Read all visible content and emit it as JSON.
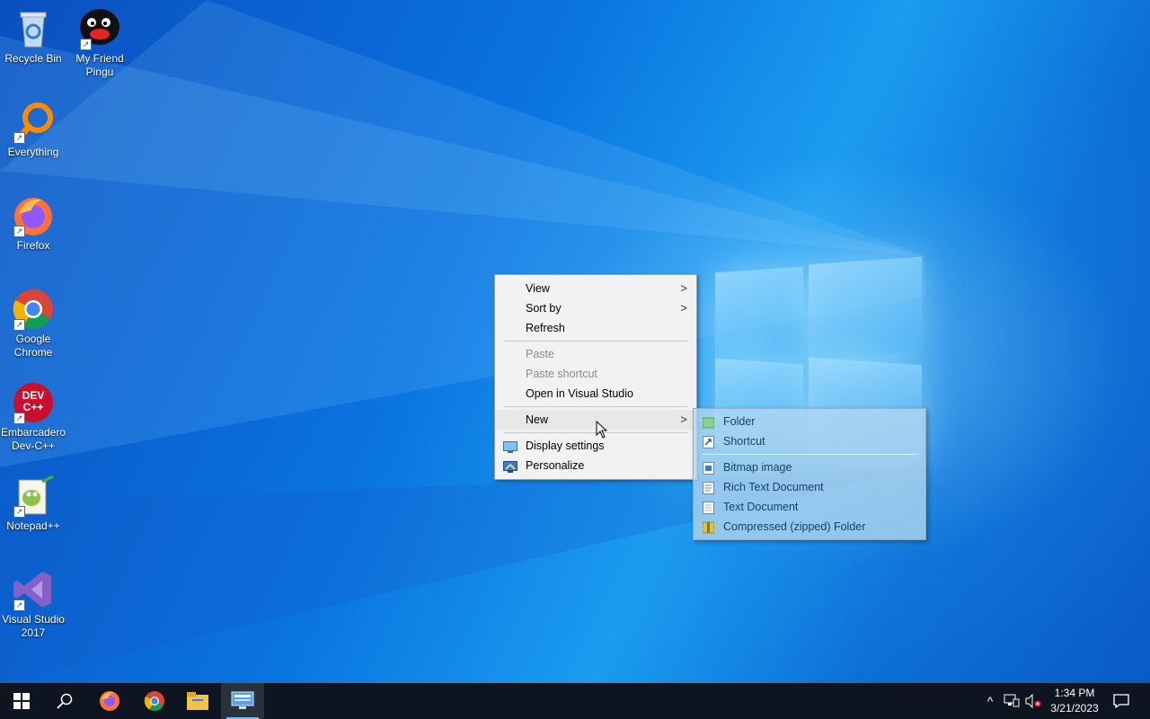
{
  "desktop_icons": [
    {
      "label": "Recycle Bin",
      "icon": "recycle-bin-icon"
    },
    {
      "label": "My Friend Pingu",
      "icon": "pingu-icon"
    },
    {
      "label": "Everything",
      "icon": "everything-search-icon"
    },
    {
      "label": "Firefox",
      "icon": "firefox-icon"
    },
    {
      "label": "Google Chrome",
      "icon": "chrome-icon"
    },
    {
      "label": "Embarcadero Dev-C++",
      "icon": "devcpp-icon",
      "glyph": "DEV C++"
    },
    {
      "label": "Notepad++",
      "icon": "notepadpp-icon"
    },
    {
      "label": "Visual Studio 2017",
      "icon": "visual-studio-icon"
    }
  ],
  "context_menu": {
    "items": [
      {
        "label": "View",
        "submenu": true,
        "enabled": true
      },
      {
        "label": "Sort by",
        "submenu": true,
        "enabled": true
      },
      {
        "label": "Refresh",
        "enabled": true
      },
      {
        "label": "Paste",
        "enabled": false
      },
      {
        "label": "Paste shortcut",
        "enabled": false
      },
      {
        "label": "Open in Visual Studio",
        "enabled": true
      },
      {
        "label": "New",
        "submenu": true,
        "enabled": true,
        "highlighted": true
      },
      {
        "label": "Display settings",
        "icon": "display-settings-icon",
        "enabled": true
      },
      {
        "label": "Personalize",
        "icon": "personalize-icon",
        "enabled": true
      }
    ],
    "chevron": ">"
  },
  "new_submenu": {
    "items": [
      {
        "label": "Folder",
        "icon": "folder-icon"
      },
      {
        "label": "Shortcut",
        "icon": "shortcut-icon"
      },
      {
        "label": "Bitmap image",
        "icon": "bitmap-image-icon"
      },
      {
        "label": "Rich Text Document",
        "icon": "rich-text-document-icon"
      },
      {
        "label": "Text Document",
        "icon": "text-document-icon"
      },
      {
        "label": "Compressed (zipped) Folder",
        "icon": "zip-folder-icon"
      }
    ]
  },
  "taskbar": {
    "pinned": [
      {
        "name": "start",
        "icon": "windows-start-icon"
      },
      {
        "name": "search",
        "icon": "search-icon"
      },
      {
        "name": "firefox",
        "icon": "firefox-icon"
      },
      {
        "name": "chrome",
        "icon": "chrome-icon"
      },
      {
        "name": "file-explorer",
        "icon": "file-explorer-icon"
      },
      {
        "name": "remote-desktop",
        "icon": "remote-desktop-icon",
        "active": true
      }
    ],
    "tray": {
      "chevron_glyph": "^",
      "icons": [
        "show-hidden-icons-icon",
        "network-icon",
        "volume-muted-icon",
        "action-center-icon"
      ]
    },
    "clock": {
      "time": "1:34 PM",
      "date": "3/21/2023"
    }
  },
  "colors": {
    "taskbar_bg": "#0e1520",
    "menu_bg": "#f2f2f2",
    "submenu_bg": "#b4d7f0",
    "active_indicator": "#76b9ed"
  }
}
